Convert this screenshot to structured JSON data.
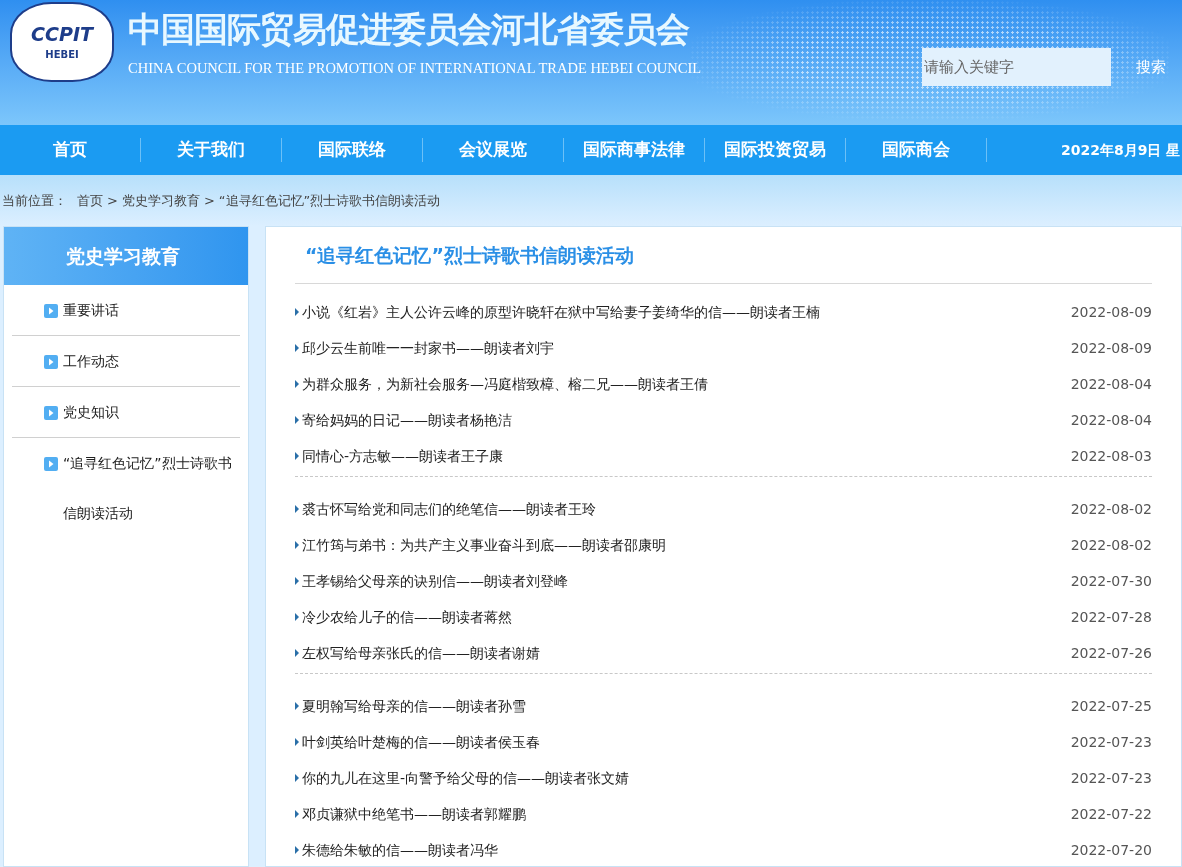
{
  "header": {
    "logo_top": "CCPIT",
    "logo_bottom": "HEBEI",
    "title": "中国国际贸易促进委员会河北省委员会",
    "subtitle": "CHINA COUNCIL FOR THE PROMOTION OF INTERNATIONAL TRADE HEBEI COUNCIL",
    "search": {
      "placeholder": "请输入关键字"
    },
    "search_button": "搜索"
  },
  "nav": {
    "items": [
      {
        "label": "首页"
      },
      {
        "label": "关于我们"
      },
      {
        "label": "国际联络"
      },
      {
        "label": "会议展览"
      },
      {
        "label": "国际商事法律"
      },
      {
        "label": "国际投资贸易"
      },
      {
        "label": "国际商会"
      }
    ],
    "date": "2022年8月9日 星"
  },
  "breadcrumb": {
    "label": "当前位置：",
    "items": [
      "首页",
      "党史学习教育",
      "“追寻红色记忆”烈士诗歌书信朗读活动"
    ],
    "separator": ">"
  },
  "sidebar": {
    "title": "党史学习教育",
    "items": [
      {
        "label": "重要讲话"
      },
      {
        "label": "工作动态"
      },
      {
        "label": "党史知识"
      },
      {
        "label": "“追寻红色记忆”烈士诗歌书信朗读活动"
      }
    ]
  },
  "content": {
    "title": "“追寻红色记忆”烈士诗歌书信朗读活动",
    "groups": [
      [
        {
          "title": "小说《红岩》主人公许云峰的原型许晓轩在狱中写给妻子姜绮华的信——朗读者王楠",
          "date": "2022-08-09"
        },
        {
          "title": "邱少云生前唯一一封家书——朗读者刘宇",
          "date": "2022-08-09"
        },
        {
          "title": "为群众服务，为新社会服务—冯庭楷致樟、榕二兄——朗读者王倩",
          "date": "2022-08-04"
        },
        {
          "title": "寄给妈妈的日记——朗读者杨艳洁",
          "date": "2022-08-04"
        },
        {
          "title": "同情心-方志敏——朗读者王子康",
          "date": "2022-08-03"
        }
      ],
      [
        {
          "title": "裘古怀写给党和同志们的绝笔信——朗读者王玲",
          "date": "2022-08-02"
        },
        {
          "title": "江竹筠与弟书：为共产主义事业奋斗到底——朗读者邵康明",
          "date": "2022-08-02"
        },
        {
          "title": "王孝锡给父母亲的诀别信——朗读者刘登峰",
          "date": "2022-07-30"
        },
        {
          "title": "冷少农给儿子的信——朗读者蒋然",
          "date": "2022-07-28"
        },
        {
          "title": "左权写给母亲张氏的信——朗读者谢婧",
          "date": "2022-07-26"
        }
      ],
      [
        {
          "title": "夏明翰写给母亲的信——朗读者孙雪",
          "date": "2022-07-25"
        },
        {
          "title": "叶剑英给叶楚梅的信——朗读者侯玉春",
          "date": "2022-07-23"
        },
        {
          "title": "你的九儿在这里-向警予给父母的信——朗读者张文婧",
          "date": "2022-07-23"
        },
        {
          "title": "邓贞谦狱中绝笔书——朗读者郭耀鹏",
          "date": "2022-07-22"
        },
        {
          "title": "朱德给朱敏的信——朗读者冯华",
          "date": "2022-07-20"
        }
      ]
    ]
  }
}
